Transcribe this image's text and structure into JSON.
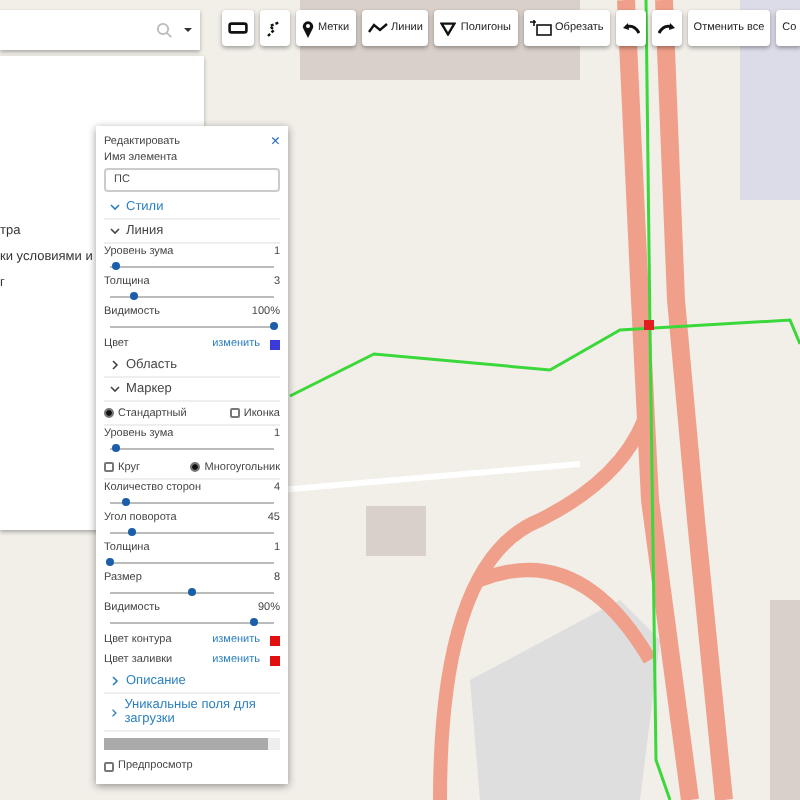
{
  "toolbar": [
    {
      "kind": "frame"
    },
    {
      "kind": "route"
    },
    {
      "kind": "pin",
      "label": "Метки"
    },
    {
      "kind": "line",
      "label": "Линии"
    },
    {
      "kind": "triangle",
      "label": "Полигоны"
    },
    {
      "kind": "crop",
      "label": "Обрезать"
    },
    {
      "kind": "undo"
    },
    {
      "kind": "redo"
    },
    {
      "kind": "text",
      "label": "Отменить все"
    },
    {
      "kind": "text",
      "label": "Со"
    }
  ],
  "sidebar": {
    "lines": [
      "тра",
      "ки условиями и",
      "г"
    ]
  },
  "panel": {
    "title": "Редактировать",
    "close": "×",
    "name_label": "Имя элемента",
    "name_value": "ПС",
    "items": [
      {
        "kind": "group",
        "label": "Стили",
        "expanded": true
      },
      {
        "kind": "section",
        "label": "Линия",
        "expanded": true
      },
      {
        "kind": "slider",
        "label": "Уровень зума",
        "value": "1",
        "level": 0.04
      },
      {
        "kind": "slider",
        "label": "Толщина",
        "value": "3",
        "level": 0.15
      },
      {
        "kind": "slider",
        "label": "Видимость",
        "value": "100%",
        "level": 1
      },
      {
        "kind": "color",
        "label": "Цвет",
        "action": "изменить",
        "color": "#3a3ad8"
      },
      {
        "kind": "section",
        "label": "Область",
        "expanded": false
      },
      {
        "kind": "section",
        "label": "Маркер",
        "expanded": true
      },
      {
        "kind": "choices",
        "options": [
          {
            "kind": "radio",
            "label": "Стандартный",
            "selected": true
          },
          {
            "kind": "checkbox",
            "label": "Иконка",
            "checked": false
          }
        ]
      },
      {
        "kind": "slider",
        "label": "Уровень зума",
        "value": "1",
        "level": 0.04
      },
      {
        "kind": "choices",
        "options": [
          {
            "kind": "checkbox",
            "label": "Круг",
            "checked": false
          },
          {
            "kind": "radio",
            "label": "Многоугольник",
            "selected": true
          }
        ]
      },
      {
        "kind": "slider",
        "label": "Количество сторон",
        "value": "4",
        "level": 0.1
      },
      {
        "kind": "slider",
        "label": "Угол поворота",
        "value": "45",
        "level": 0.14
      },
      {
        "kind": "slider",
        "label": "Толщина",
        "value": "1",
        "level": 0
      },
      {
        "kind": "slider",
        "label": "Размер",
        "value": "8",
        "level": 0.5
      },
      {
        "kind": "slider",
        "label": "Видимость",
        "value": "90%",
        "level": 0.88
      },
      {
        "kind": "color",
        "label": "Цвет контура",
        "action": "изменить",
        "color": "#e01010"
      },
      {
        "kind": "color",
        "label": "Цвет заливки",
        "action": "изменить",
        "color": "#e01010"
      },
      {
        "kind": "group",
        "label": "Описание",
        "expanded": false
      },
      {
        "kind": "group",
        "label": "Уникальные поля для загрузки",
        "expanded": false
      },
      {
        "kind": "progress",
        "level": 0.93
      },
      {
        "kind": "checkbox",
        "label": "Предпросмотр",
        "checked": false
      }
    ]
  }
}
